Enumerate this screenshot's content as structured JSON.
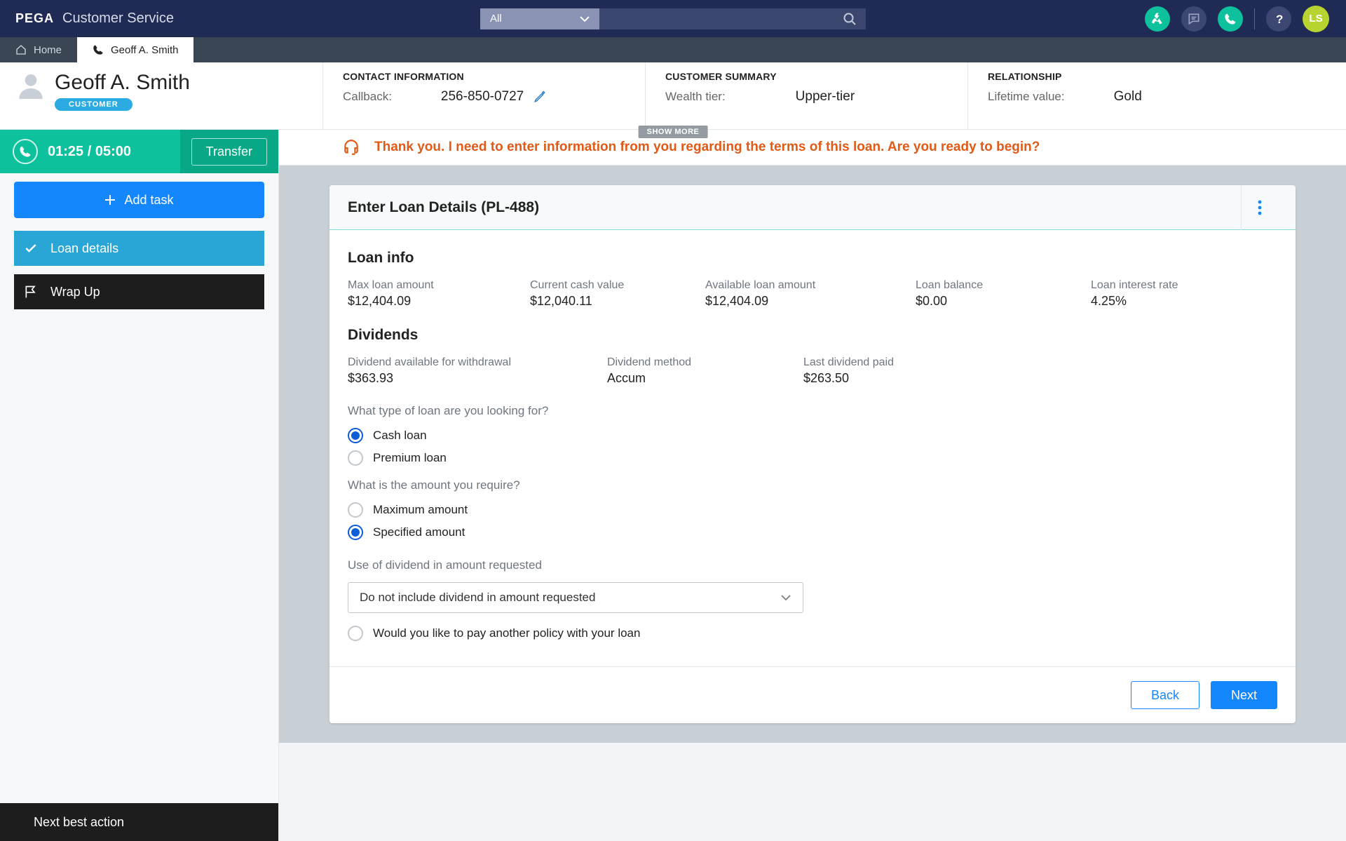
{
  "topnav": {
    "brand_logo": "PEGA",
    "brand_title": "Customer Service",
    "search_filter": "All",
    "avatar_initials": "LS"
  },
  "tabs": {
    "home": "Home",
    "active": "Geoff A. Smith"
  },
  "customer_header": {
    "name": "Geoff A. Smith",
    "badge": "CUSTOMER",
    "contact": {
      "heading": "CONTACT INFORMATION",
      "callback_label": "Callback:",
      "callback_value": "256-850-0727"
    },
    "summary": {
      "heading": "CUSTOMER SUMMARY",
      "wealth_label": "Wealth tier:",
      "wealth_value": "Upper-tier"
    },
    "relationship": {
      "heading": "RELATIONSHIP",
      "ltv_label": "Lifetime value:",
      "ltv_value": "Gold"
    },
    "show_more": "SHOW MORE"
  },
  "call": {
    "timer": "01:25 / 05:00",
    "transfer": "Transfer"
  },
  "tasks": {
    "add": "Add task",
    "loan": "Loan details",
    "wrap": "Wrap Up"
  },
  "next_best_action": "Next best action",
  "suggest": "Thank you. I need to enter information from you regarding the terms of this loan. Are you ready to begin?",
  "card": {
    "title": "Enter Loan Details (PL-488)",
    "loan_info_heading": "Loan info",
    "loan_info": {
      "max_loan_label": "Max loan amount",
      "max_loan_value": "$12,404.09",
      "cash_value_label": "Current cash value",
      "cash_value_value": "$12,040.11",
      "avail_label": "Available loan amount",
      "avail_value": "$12,404.09",
      "balance_label": "Loan balance",
      "balance_value": "$0.00",
      "rate_label": "Loan interest rate",
      "rate_value": "4.25%"
    },
    "dividends_heading": "Dividends",
    "dividends": {
      "avail_label": "Dividend available for withdrawal",
      "avail_value": "$363.93",
      "method_label": "Dividend method",
      "method_value": "Accum",
      "last_label": "Last dividend paid",
      "last_value": "$263.50"
    },
    "q_loan_type": "What type of loan are you looking for?",
    "opt_cash": "Cash loan",
    "opt_premium": "Premium loan",
    "q_amount": "What is the amount you require?",
    "opt_max": "Maximum amount",
    "opt_spec": "Specified amount",
    "q_dividend_use": "Use of dividend in amount requested",
    "dividend_select": "Do not include dividend in amount requested",
    "chk_pay_other": "Would you like to pay another policy with your loan",
    "back": "Back",
    "next": "Next"
  }
}
